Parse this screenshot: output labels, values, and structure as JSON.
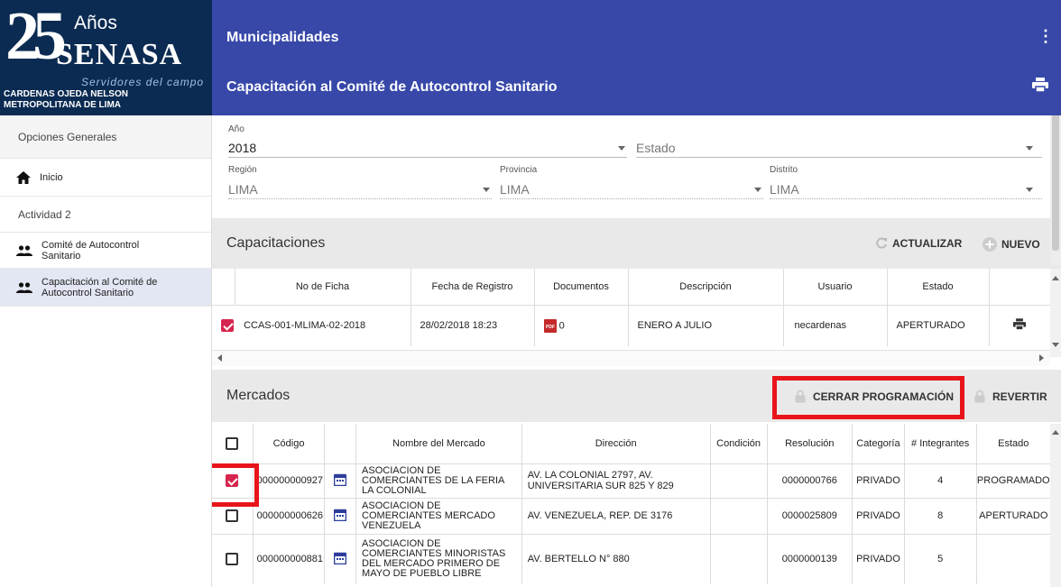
{
  "brand": {
    "number": "25",
    "anos": "Años",
    "name": "SENASA",
    "tagline": "Servidores del campo",
    "user_name": "CARDENAS OJEDA NELSON",
    "user_office": "METROPOLITANA DE LIMA"
  },
  "header": {
    "title": "Municipalidades",
    "subtitle": "Capacitación al Comité de Autocontrol Sanitario",
    "menu_glyph": "⋮"
  },
  "sidebar": {
    "section1": "Opciones Generales",
    "inicio": "Inicio",
    "section2": "Actividad 2",
    "item1": "Comité de Autocontrol Sanitario",
    "item2": "Capacitación al Comité de Autocontrol Sanitario"
  },
  "filters": {
    "anio_label": "Año",
    "anio_value": "2018",
    "estado_placeholder": "Estado",
    "region_label": "Región",
    "region_value": "LIMA",
    "provincia_label": "Provincia",
    "provincia_value": "LIMA",
    "distrito_label": "Distrito",
    "distrito_value": "LIMA"
  },
  "capacitaciones": {
    "title": "Capacitaciones",
    "actualizar": "ACTUALIZAR",
    "nuevo": "NUEVO",
    "columns": [
      "No de Ficha",
      "Fecha de Registro",
      "Documentos",
      "Descripción",
      "Usuario",
      "Estado"
    ],
    "row": {
      "ficha": "CCAS-001-MLIMA-02-2018",
      "fecha": "28/02/2018 18:23",
      "documentos": "0",
      "descripcion": "ENERO A JULIO",
      "usuario": "necardenas",
      "estado": "APERTURADO"
    }
  },
  "mercados": {
    "title": "Mercados",
    "cerrar": "CERRAR PROGRAMACIÓN",
    "revertir": "REVERTIR",
    "columns": [
      "Código",
      "Nombre del Mercado",
      "Dirección",
      "Condición",
      "Resolución",
      "Categoría",
      "# Integrantes",
      "Estado"
    ],
    "rows": [
      {
        "codigo": "000000000927",
        "nombre": "ASOCIACION DE COMERCIANTES DE LA FERIA LA COLONIAL",
        "direccion": "AV. LA COLONIAL 2797, AV. UNIVERSITARIA SUR 825 Y 829",
        "condicion": "",
        "resolucion": "0000000766",
        "categoria": "PRIVADO",
        "integrantes": "4",
        "estado": "PROGRAMADO"
      },
      {
        "codigo": "000000000626",
        "nombre": "ASOCIACION DE COMERCIANTES MERCADO VENEZUELA",
        "direccion": "AV. VENEZUELA, REP. DE 3176",
        "condicion": "",
        "resolucion": "0000025809",
        "categoria": "PRIVADO",
        "integrantes": "8",
        "estado": "APERTURADO"
      },
      {
        "codigo": "000000000881",
        "nombre": "ASOCIACION DE COMERCIANTES MINORISTAS DEL MERCADO PRIMERO DE MAYO DE PUEBLO LIBRE",
        "direccion": "AV. BERTELLO N° 880",
        "condicion": "",
        "resolucion": "0000000139",
        "categoria": "PRIVADO",
        "integrantes": "5",
        "estado": ""
      }
    ]
  },
  "colors": {
    "header": "#3748a9",
    "brand": "#0b2b52",
    "accent_check": "#d6254e",
    "highlight": "#e8141a"
  }
}
